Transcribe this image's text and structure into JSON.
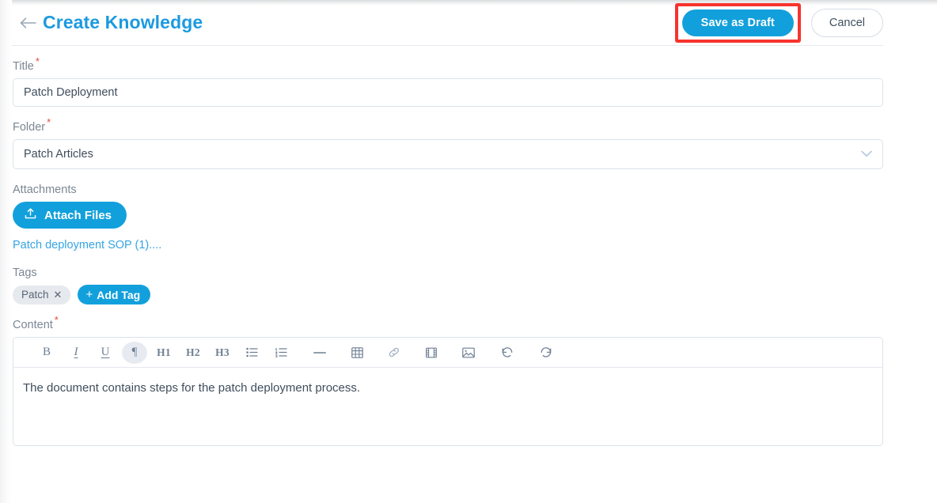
{
  "header": {
    "back_icon": "arrow-left-icon",
    "title": "Create Knowledge",
    "save_label": "Save as Draft",
    "cancel_label": "Cancel",
    "highlight_color": "#f8332e",
    "accent_color": "#12a0dc"
  },
  "form": {
    "title_field": {
      "label": "Title",
      "required_mark": "*",
      "value": "Patch Deployment",
      "placeholder": "Title"
    },
    "folder_field": {
      "label": "Folder",
      "required_mark": "*",
      "value": "Patch Articles",
      "chevron_icon": "chevron-down-icon"
    },
    "attachments": {
      "label": "Attachments",
      "button_label": "Attach Files",
      "button_icon": "upload-icon",
      "files": [
        {
          "name": "Patch deployment SOP (1)...."
        }
      ]
    },
    "tags": {
      "label": "Tags",
      "chips": [
        {
          "label": "Patch",
          "remove_icon": "close-icon"
        }
      ],
      "add_label": "Add Tag",
      "add_icon": "plus-icon"
    },
    "content_field": {
      "label": "Content",
      "required_mark": "*",
      "value": "The document contains steps for the patch deployment process.",
      "toolbar": [
        {
          "name": "bold-icon",
          "glyph": "B",
          "active": false
        },
        {
          "name": "italic-icon",
          "glyph": "I",
          "active": false
        },
        {
          "name": "underline-icon",
          "glyph": "U",
          "active": false
        },
        {
          "name": "paragraph-icon",
          "glyph": "¶",
          "active": true
        },
        {
          "name": "heading-1-icon",
          "glyph": "H1",
          "active": false
        },
        {
          "name": "heading-2-icon",
          "glyph": "H2",
          "active": false
        },
        {
          "name": "heading-3-icon",
          "glyph": "H3",
          "active": false
        },
        {
          "name": "bulleted-list-icon",
          "glyph": "",
          "active": false
        },
        {
          "name": "numbered-list-icon",
          "glyph": "",
          "active": false
        },
        {
          "name": "horizontal-rule-icon",
          "glyph": "",
          "active": false
        },
        {
          "name": "table-icon",
          "glyph": "",
          "active": false
        },
        {
          "name": "link-icon",
          "glyph": "",
          "active": false
        },
        {
          "name": "video-icon",
          "glyph": "",
          "active": false
        },
        {
          "name": "image-icon",
          "glyph": "",
          "active": false
        },
        {
          "name": "undo-icon",
          "glyph": "",
          "active": false
        },
        {
          "name": "redo-icon",
          "glyph": "",
          "active": false
        }
      ]
    }
  }
}
